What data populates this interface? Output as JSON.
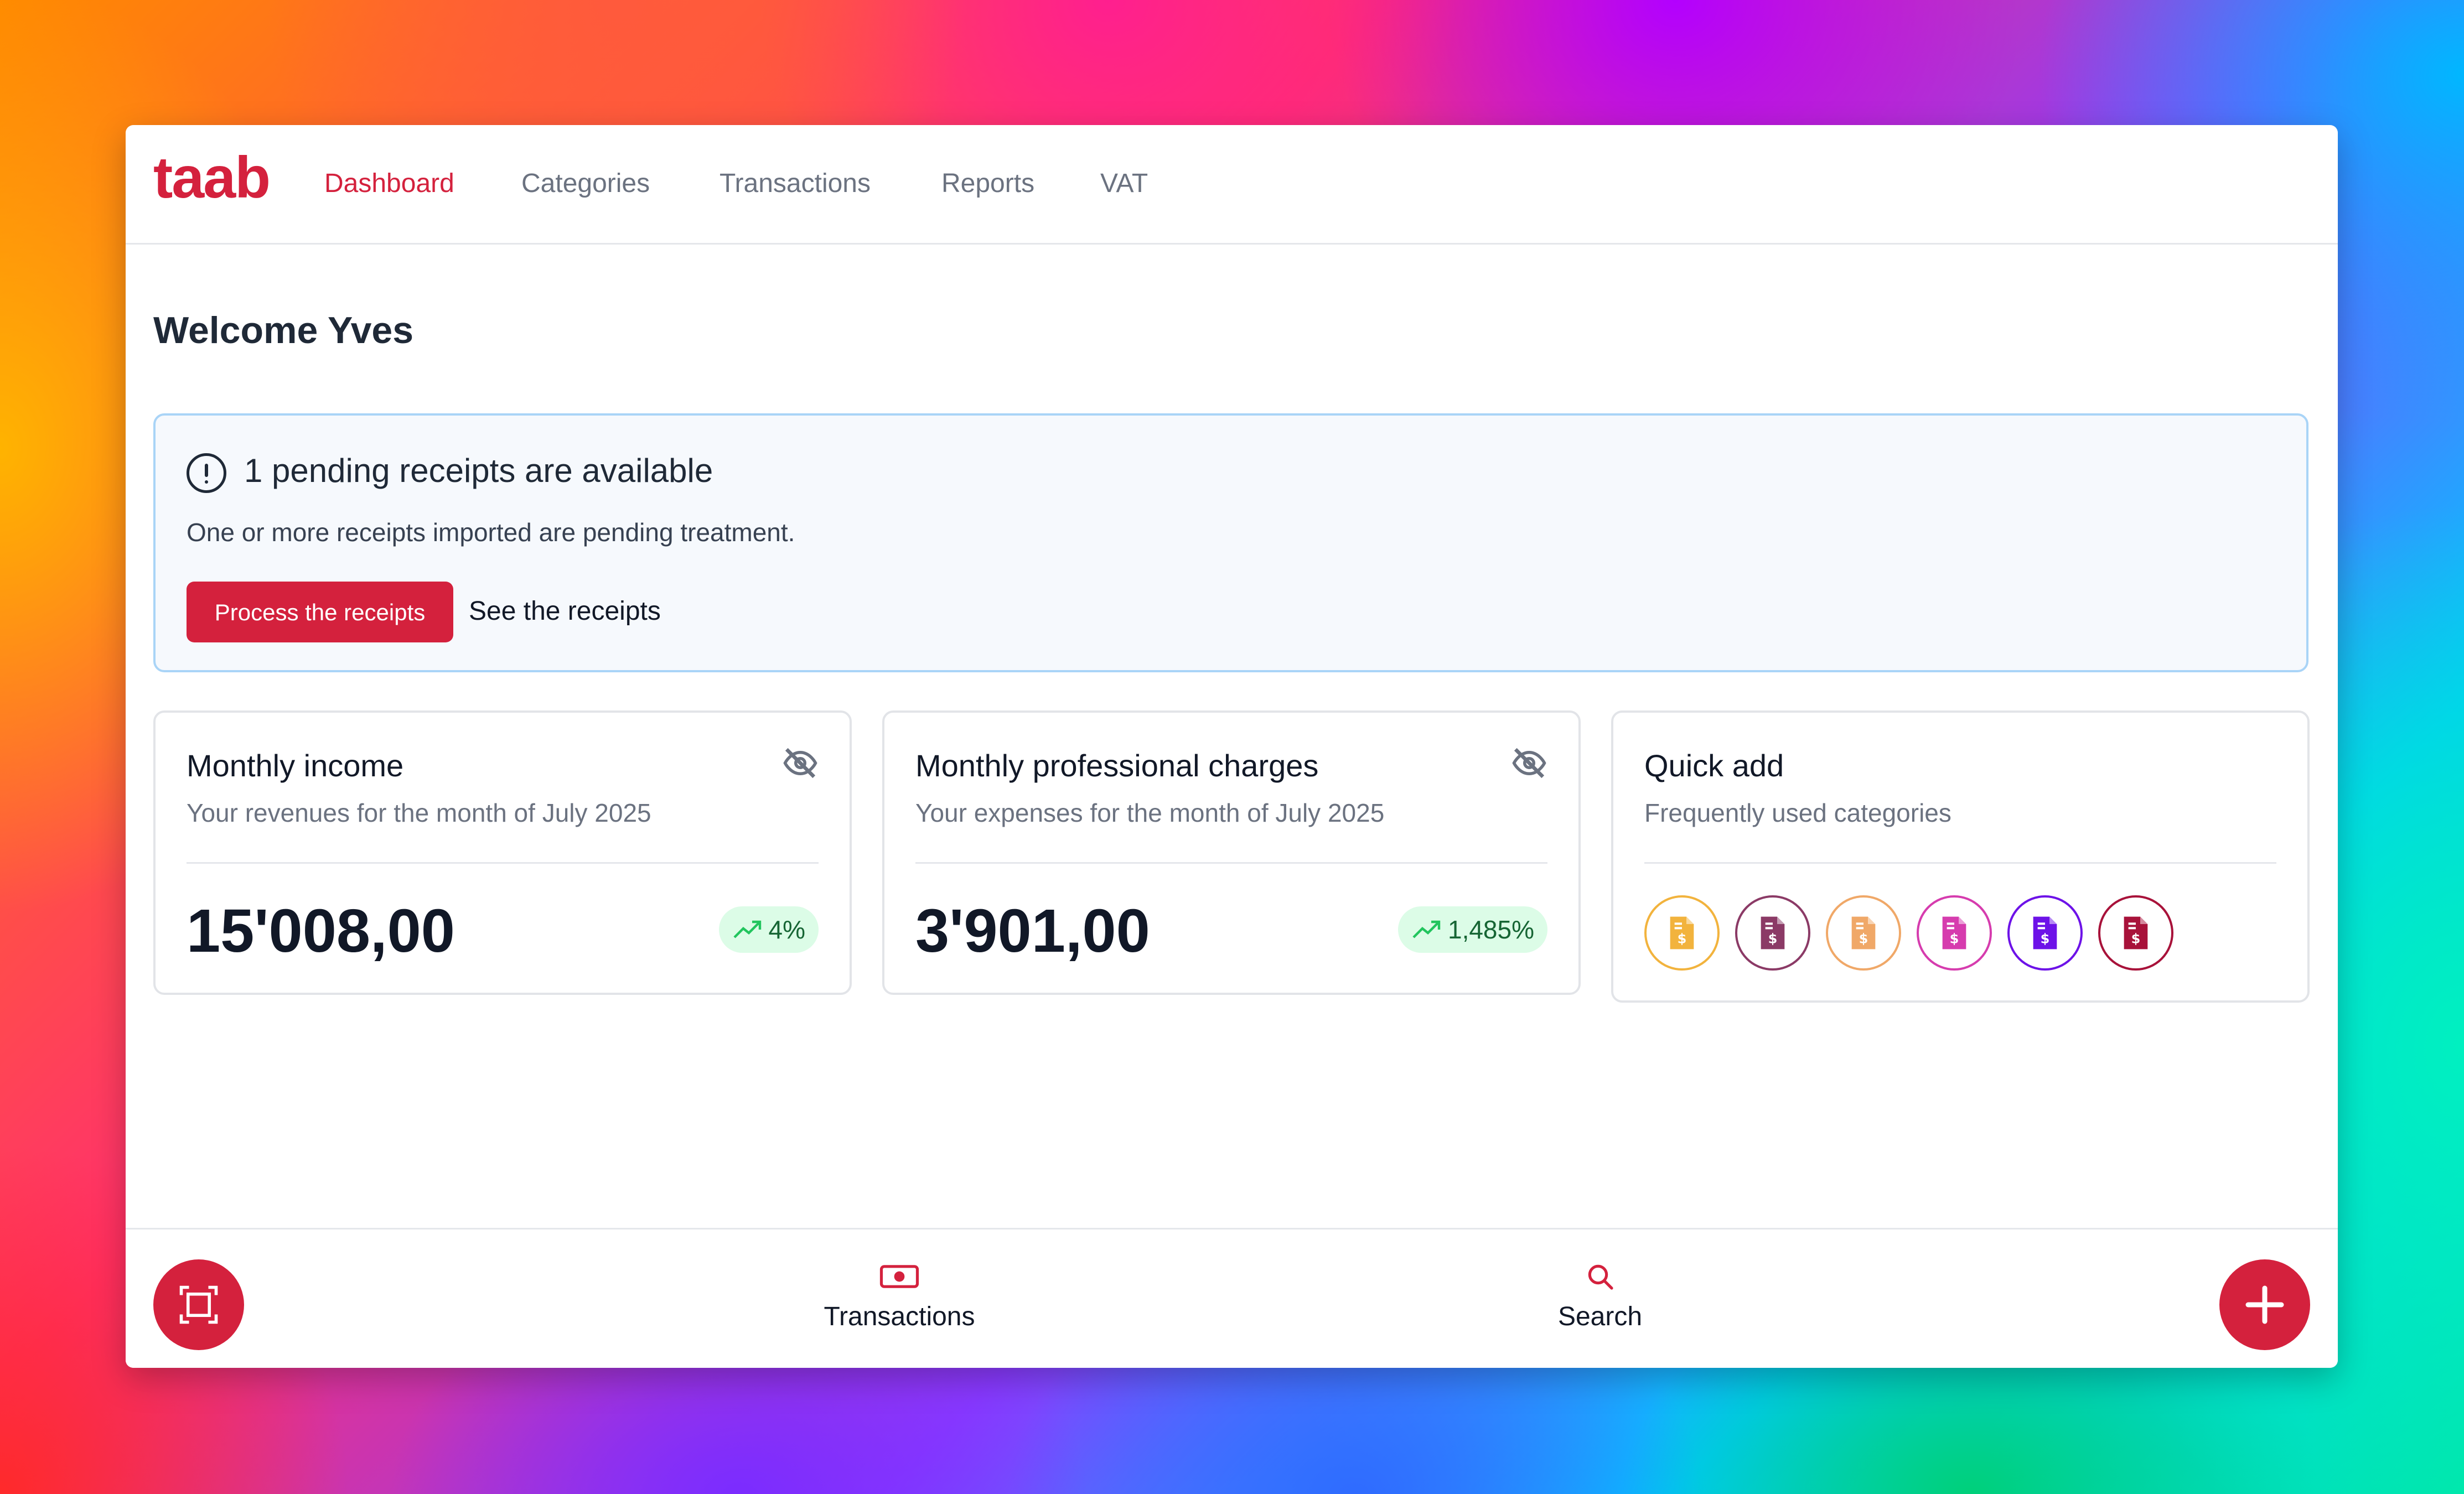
{
  "app": {
    "logo": "taab",
    "brand_color": "#d4213d"
  },
  "nav": {
    "items": [
      {
        "label": "Dashboard",
        "active": true
      },
      {
        "label": "Categories",
        "active": false
      },
      {
        "label": "Transactions",
        "active": false
      },
      {
        "label": "Reports",
        "active": false
      },
      {
        "label": "VAT",
        "active": false
      }
    ]
  },
  "welcome": "Welcome Yves",
  "alert": {
    "icon": "alert-circle-icon",
    "title": "1 pending receipts are available",
    "description": "One or more receipts imported are pending treatment.",
    "primary_button": "Process the receipts",
    "link_button": "See the receipts"
  },
  "cards": {
    "income": {
      "title": "Monthly income",
      "subtitle": "Your revenues for the month of July 2025",
      "value": "15'008,00",
      "trend": "4%",
      "trend_icon": "trending-up-icon",
      "visibility_icon": "eye-off-icon"
    },
    "charges": {
      "title": "Monthly professional charges",
      "subtitle": "Your expenses for the month of July 2025",
      "value": "3'901,00",
      "trend": "1,485%",
      "trend_icon": "trending-up-icon",
      "visibility_icon": "eye-off-icon"
    },
    "quick_add": {
      "title": "Quick add",
      "subtitle": "Frequently used categories",
      "category_colors": [
        "#f2b33d",
        "#8b3a66",
        "#f0a868",
        "#d63cae",
        "#6d12e8",
        "#a8123a"
      ]
    }
  },
  "bottom_bar": {
    "scan_icon": "scan-icon",
    "tabs": [
      {
        "label": "Transactions",
        "icon": "banknote-icon"
      },
      {
        "label": "Search",
        "icon": "search-icon"
      }
    ],
    "add_icon": "plus-icon"
  }
}
